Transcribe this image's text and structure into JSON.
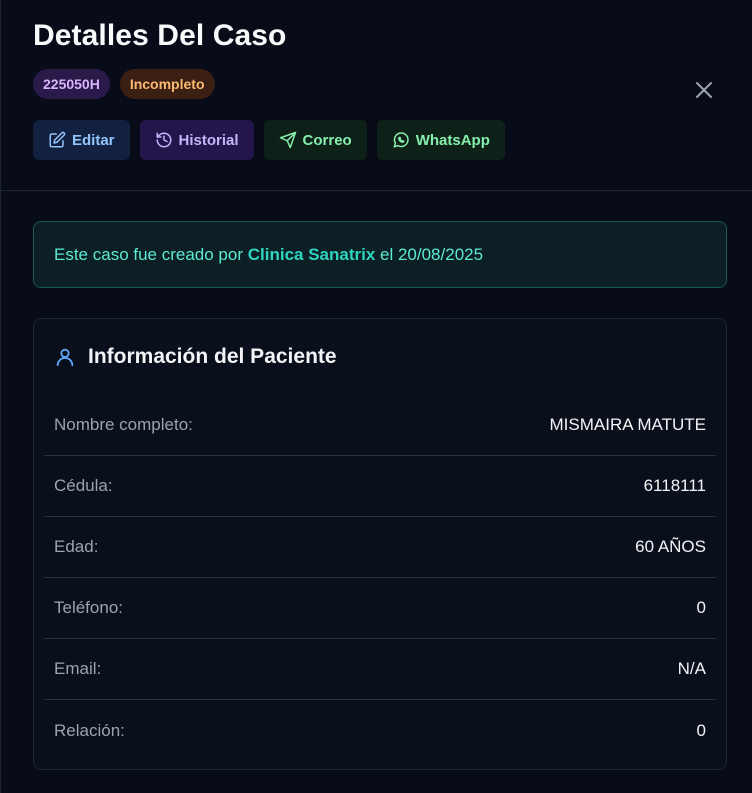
{
  "header": {
    "title": "Detalles Del Caso",
    "code_badge": "225050H",
    "status_badge": "Incompleto",
    "actions": {
      "edit": "Editar",
      "history": "Historial",
      "mail": "Correo",
      "whatsapp": "WhatsApp"
    }
  },
  "banner": {
    "prefix": "Este caso fue creado por ",
    "creator": "Clinica Sanatrix",
    "suffix": " el 20/08/2025"
  },
  "patient": {
    "title": "Información del Paciente",
    "rows": [
      {
        "label": "Nombre completo:",
        "value": "MISMAIRA MATUTE"
      },
      {
        "label": "Cédula:",
        "value": "6118111"
      },
      {
        "label": "Edad:",
        "value": "60 AÑOS"
      },
      {
        "label": "Teléfono:",
        "value": "0"
      },
      {
        "label": "Email:",
        "value": "N/A"
      },
      {
        "label": "Relación:",
        "value": "0"
      }
    ]
  },
  "icons": {
    "close": "close-icon",
    "edit": "edit-icon",
    "history": "history-icon",
    "mail": "send-icon",
    "whatsapp": "whatsapp-icon",
    "patient": "user-icon"
  },
  "colors": {
    "accent_teal": "#2dd4bf",
    "badge_code": "#d8b4fe",
    "badge_status": "#fdba74"
  }
}
